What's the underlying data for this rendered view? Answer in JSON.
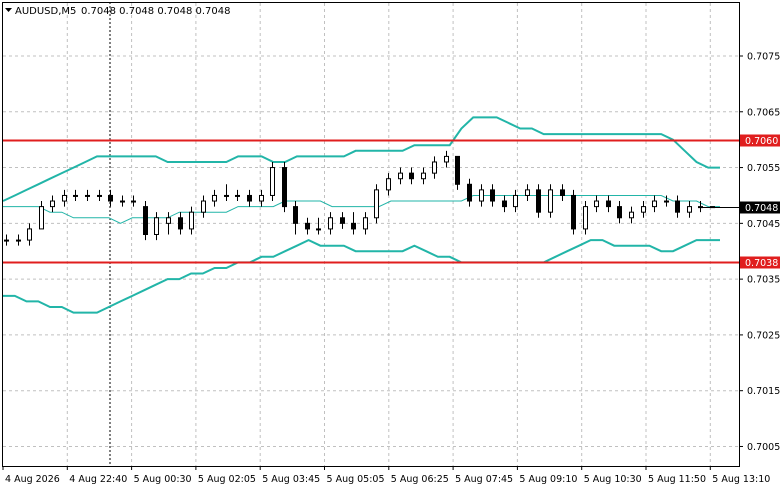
{
  "header": {
    "symbol": "AUDUSD,M5",
    "ohlc": "0.7048 0.7048 0.7048 0.7048"
  },
  "chart_data": {
    "type": "candlestick",
    "symbol": "AUDUSD",
    "timeframe": "M5",
    "grid": true,
    "ylim": [
      0.70015,
      0.70845
    ],
    "y_ticks": [
      "0.7075",
      "0.7065",
      "0.7055",
      "0.7045",
      "0.7035",
      "0.7025",
      "0.7015",
      "0.7005"
    ],
    "x_ticks": [
      "4 Aug 2026",
      "4 Aug 22:40",
      "5 Aug 00:30",
      "5 Aug 02:05",
      "5 Aug 03:45",
      "5 Aug 05:05",
      "5 Aug 06:25",
      "5 Aug 07:45",
      "5 Aug 09:10",
      "5 Aug 10:30",
      "5 Aug 11:50",
      "5 Aug 13:10"
    ],
    "levels": [
      {
        "value": 0.706,
        "label": "0.7060",
        "color": "#e01e1e"
      },
      {
        "value": 0.7038,
        "label": "0.7038",
        "color": "#e01e1e"
      }
    ],
    "current_price": {
      "value": 0.7048,
      "label": "0.7048"
    },
    "crosshair_time": "4 Aug 22:40",
    "colors": {
      "bands": "#22b5a8",
      "levels": "#e01e1e",
      "candles": "#000000"
    },
    "bollinger": {
      "upper": [
        0.7049,
        0.705,
        0.7051,
        0.7052,
        0.7053,
        0.7054,
        0.7055,
        0.7056,
        0.7057,
        0.7057,
        0.7057,
        0.7057,
        0.7057,
        0.7057,
        0.7056,
        0.7056,
        0.7056,
        0.7056,
        0.7056,
        0.7056,
        0.7057,
        0.7057,
        0.7057,
        0.7056,
        0.7056,
        0.7057,
        0.7057,
        0.7057,
        0.7057,
        0.7057,
        0.7058,
        0.7058,
        0.7058,
        0.7058,
        0.7058,
        0.7059,
        0.7059,
        0.7059,
        0.7059,
        0.7062,
        0.7064,
        0.7064,
        0.7064,
        0.7063,
        0.7062,
        0.7062,
        0.7061,
        0.7061,
        0.7061,
        0.7061,
        0.7061,
        0.7061,
        0.7061,
        0.7061,
        0.7061,
        0.7061,
        0.7061,
        0.706,
        0.7058,
        0.7056,
        0.7055,
        0.7055
      ],
      "middle": [
        0.7048,
        0.7048,
        0.7048,
        0.7048,
        0.7047,
        0.7047,
        0.7046,
        0.7046,
        0.7046,
        0.7046,
        0.7045,
        0.7046,
        0.7046,
        0.7046,
        0.7046,
        0.7047,
        0.7047,
        0.7047,
        0.7047,
        0.7047,
        0.7048,
        0.7048,
        0.7048,
        0.7048,
        0.7049,
        0.7049,
        0.7049,
        0.7049,
        0.7048,
        0.7048,
        0.7048,
        0.7048,
        0.7048,
        0.7049,
        0.7049,
        0.7049,
        0.7049,
        0.7049,
        0.7049,
        0.7049,
        0.705,
        0.705,
        0.705,
        0.705,
        0.705,
        0.705,
        0.705,
        0.705,
        0.705,
        0.705,
        0.705,
        0.705,
        0.705,
        0.705,
        0.705,
        0.705,
        0.705,
        0.7049,
        0.7049,
        0.7049,
        0.7048,
        0.7048
      ],
      "lower": [
        0.7032,
        0.7032,
        0.7031,
        0.7031,
        0.703,
        0.703,
        0.7029,
        0.7029,
        0.7029,
        0.703,
        0.7031,
        0.7032,
        0.7033,
        0.7034,
        0.7035,
        0.7035,
        0.7036,
        0.7036,
        0.7037,
        0.7037,
        0.7038,
        0.7038,
        0.7039,
        0.7039,
        0.704,
        0.7041,
        0.7042,
        0.7041,
        0.7041,
        0.7041,
        0.704,
        0.704,
        0.704,
        0.704,
        0.704,
        0.7041,
        0.704,
        0.7039,
        0.7039,
        0.7038,
        0.7038,
        0.7038,
        0.7038,
        0.7038,
        0.7038,
        0.7038,
        0.7038,
        0.7039,
        0.704,
        0.7041,
        0.7042,
        0.7042,
        0.7041,
        0.7041,
        0.7041,
        0.7041,
        0.704,
        0.704,
        0.7041,
        0.7042,
        0.7042,
        0.7042
      ]
    },
    "candles": [
      [
        0.7042,
        0.7043,
        0.7041,
        0.7042
      ],
      [
        0.7042,
        0.7043,
        0.7041,
        0.7042
      ],
      [
        0.7042,
        0.7045,
        0.7041,
        0.7044
      ],
      [
        0.7044,
        0.7049,
        0.7044,
        0.7048
      ],
      [
        0.7048,
        0.705,
        0.7047,
        0.7049
      ],
      [
        0.7049,
        0.7051,
        0.7048,
        0.705
      ],
      [
        0.705,
        0.7051,
        0.7049,
        0.705
      ],
      [
        0.705,
        0.7051,
        0.7049,
        0.705
      ],
      [
        0.705,
        0.7051,
        0.7049,
        0.705
      ],
      [
        0.705,
        0.7051,
        0.7048,
        0.7049
      ],
      [
        0.7049,
        0.705,
        0.7048,
        0.7049
      ],
      [
        0.7049,
        0.705,
        0.7048,
        0.7049
      ],
      [
        0.7048,
        0.7049,
        0.7042,
        0.7043
      ],
      [
        0.7043,
        0.7047,
        0.7042,
        0.7046
      ],
      [
        0.7045,
        0.7047,
        0.7043,
        0.7046
      ],
      [
        0.7046,
        0.7047,
        0.7043,
        0.7044
      ],
      [
        0.7044,
        0.7048,
        0.7043,
        0.7047
      ],
      [
        0.7047,
        0.705,
        0.7046,
        0.7049
      ],
      [
        0.7049,
        0.7051,
        0.7048,
        0.705
      ],
      [
        0.705,
        0.7052,
        0.7049,
        0.705
      ],
      [
        0.705,
        0.7051,
        0.7049,
        0.705
      ],
      [
        0.705,
        0.7051,
        0.7048,
        0.7049
      ],
      [
        0.7049,
        0.7051,
        0.7048,
        0.705
      ],
      [
        0.705,
        0.7056,
        0.7049,
        0.7055
      ],
      [
        0.7055,
        0.7056,
        0.7047,
        0.7048
      ],
      [
        0.7048,
        0.7049,
        0.7043,
        0.7045
      ],
      [
        0.7045,
        0.7046,
        0.7043,
        0.7044
      ],
      [
        0.7044,
        0.7046,
        0.7043,
        0.7044
      ],
      [
        0.7044,
        0.7047,
        0.7043,
        0.7046
      ],
      [
        0.7046,
        0.7047,
        0.7044,
        0.7045
      ],
      [
        0.7045,
        0.7047,
        0.7043,
        0.7044
      ],
      [
        0.7044,
        0.7047,
        0.7043,
        0.7046
      ],
      [
        0.7046,
        0.7052,
        0.7045,
        0.7051
      ],
      [
        0.7051,
        0.7054,
        0.705,
        0.7053
      ],
      [
        0.7053,
        0.7055,
        0.7052,
        0.7054
      ],
      [
        0.7054,
        0.7055,
        0.7052,
        0.7053
      ],
      [
        0.7053,
        0.7055,
        0.7052,
        0.7054
      ],
      [
        0.7054,
        0.7057,
        0.7053,
        0.7056
      ],
      [
        0.7056,
        0.7058,
        0.7055,
        0.7057
      ],
      [
        0.7057,
        0.7057,
        0.7051,
        0.7052
      ],
      [
        0.7052,
        0.7053,
        0.7048,
        0.7049
      ],
      [
        0.7049,
        0.7052,
        0.7048,
        0.7051
      ],
      [
        0.7051,
        0.7052,
        0.7048,
        0.7049
      ],
      [
        0.7049,
        0.705,
        0.7047,
        0.7048
      ],
      [
        0.7048,
        0.7051,
        0.7047,
        0.705
      ],
      [
        0.705,
        0.7052,
        0.7049,
        0.7051
      ],
      [
        0.7051,
        0.7052,
        0.7046,
        0.7047
      ],
      [
        0.7047,
        0.7052,
        0.7046,
        0.7051
      ],
      [
        0.7051,
        0.7052,
        0.7049,
        0.705
      ],
      [
        0.705,
        0.7051,
        0.7043,
        0.7044
      ],
      [
        0.7044,
        0.7049,
        0.7043,
        0.7048
      ],
      [
        0.7048,
        0.705,
        0.7047,
        0.7049
      ],
      [
        0.7049,
        0.705,
        0.7047,
        0.7048
      ],
      [
        0.7048,
        0.7049,
        0.7045,
        0.7046
      ],
      [
        0.7046,
        0.7048,
        0.7045,
        0.7047
      ],
      [
        0.7047,
        0.7049,
        0.7046,
        0.7048
      ],
      [
        0.7048,
        0.705,
        0.7047,
        0.7049
      ],
      [
        0.7049,
        0.705,
        0.7048,
        0.7049
      ],
      [
        0.7049,
        0.705,
        0.7046,
        0.7047
      ],
      [
        0.7047,
        0.7049,
        0.7046,
        0.7048
      ],
      [
        0.7048,
        0.7049,
        0.7047,
        0.7048
      ],
      [
        0.7048,
        0.7048,
        0.7048,
        0.7048
      ]
    ]
  }
}
